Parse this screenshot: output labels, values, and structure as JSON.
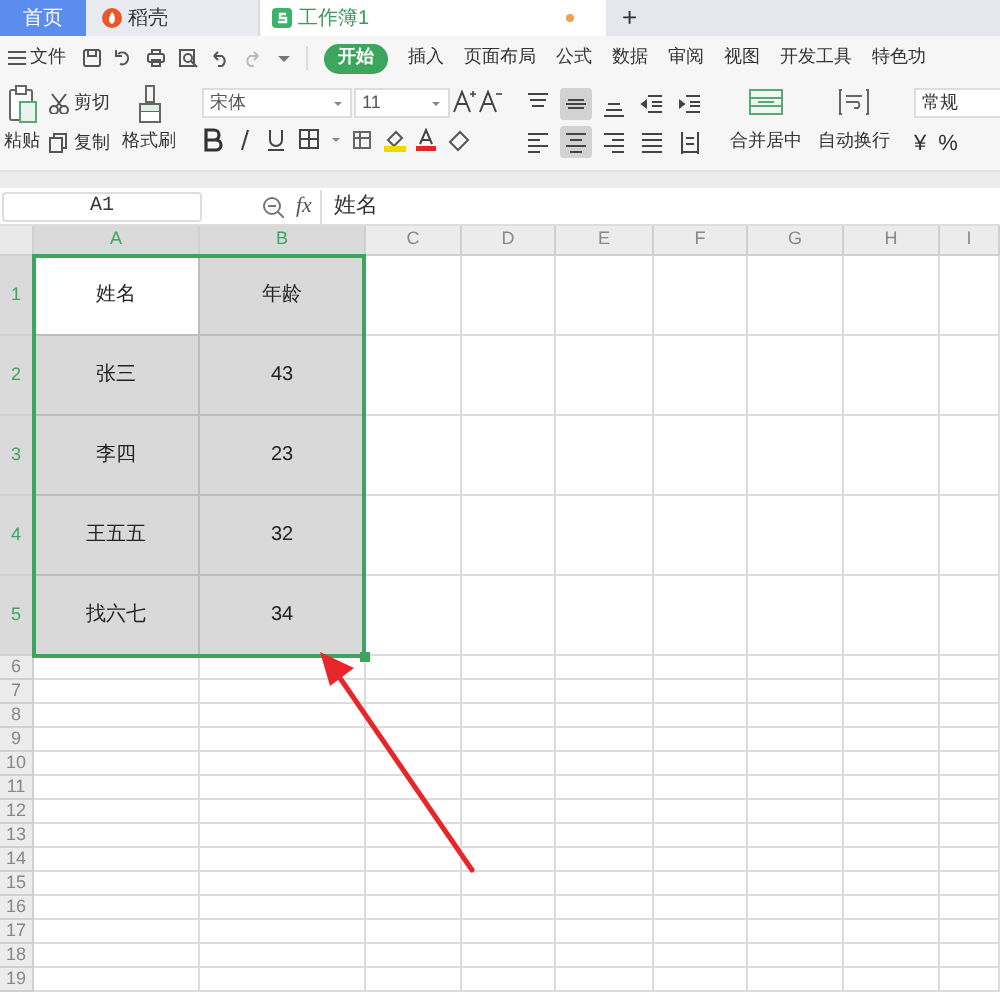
{
  "doc_tabs": [
    {
      "label": "首页",
      "kind": "home",
      "selected": false
    },
    {
      "label": "稻壳",
      "kind": "docer",
      "selected": false
    },
    {
      "label": "工作簿1",
      "kind": "sheet",
      "selected": true,
      "unsaved": true
    }
  ],
  "new_tab": "+",
  "menu": {
    "file": "文件",
    "tabs": [
      {
        "label": "开始",
        "selected": true
      },
      {
        "label": "插入",
        "selected": false
      },
      {
        "label": "页面布局",
        "selected": false
      },
      {
        "label": "公式",
        "selected": false
      },
      {
        "label": "数据",
        "selected": false
      },
      {
        "label": "审阅",
        "selected": false
      },
      {
        "label": "视图",
        "selected": false
      },
      {
        "label": "开发工具",
        "selected": false
      },
      {
        "label": "特色功",
        "selected": false
      }
    ]
  },
  "ribbon": {
    "paste": "粘贴",
    "cut": "剪切",
    "copy": "复制",
    "format_painter": "格式刷",
    "font": "宋体",
    "font_size": "11",
    "merge": "合并居中",
    "wrap": "自动换行",
    "number_format": "常规",
    "currency": "¥",
    "percent": "%",
    "align_top": [
      {
        "kind": "top",
        "selected": false
      },
      {
        "kind": "middle",
        "selected": true
      },
      {
        "kind": "bottom",
        "selected": false
      },
      {
        "kind": "outdent",
        "selected": false
      },
      {
        "kind": "indent",
        "selected": false
      }
    ],
    "align_bottom": [
      {
        "kind": "left",
        "selected": false
      },
      {
        "kind": "center",
        "selected": true
      },
      {
        "kind": "right",
        "selected": false
      },
      {
        "kind": "justify",
        "selected": false
      },
      {
        "kind": "distribute",
        "selected": false
      }
    ]
  },
  "formula_bar": {
    "cell": "A1",
    "fx": "fx",
    "value": "姓名"
  },
  "columns": [
    {
      "label": "A",
      "selected": true
    },
    {
      "label": "B",
      "selected": true
    },
    {
      "label": "C",
      "selected": false
    },
    {
      "label": "D",
      "selected": false
    },
    {
      "label": "E",
      "selected": false
    },
    {
      "label": "F",
      "selected": false
    },
    {
      "label": "G",
      "selected": false
    },
    {
      "label": "H",
      "selected": false
    },
    {
      "label": "I",
      "selected": false
    }
  ],
  "rows": [
    {
      "number": "1",
      "selected": true,
      "cells": [
        {
          "text": "姓名",
          "active": true
        },
        {
          "text": "年龄",
          "active": false
        }
      ]
    },
    {
      "number": "2",
      "selected": true,
      "cells": [
        {
          "text": "张三",
          "active": false
        },
        {
          "text": "43",
          "active": false
        }
      ]
    },
    {
      "number": "3",
      "selected": true,
      "cells": [
        {
          "text": "李四",
          "active": false
        },
        {
          "text": "23",
          "active": false
        }
      ]
    },
    {
      "number": "4",
      "selected": true,
      "cells": [
        {
          "text": "王五五",
          "active": false
        },
        {
          "text": "32",
          "active": false
        }
      ]
    },
    {
      "number": "5",
      "selected": true,
      "cells": [
        {
          "text": "找六七",
          "active": false
        },
        {
          "text": "34",
          "active": false
        }
      ]
    },
    {
      "number": "6",
      "selected": false,
      "cells": []
    },
    {
      "number": "7",
      "selected": false,
      "cells": []
    },
    {
      "number": "8",
      "selected": false,
      "cells": []
    },
    {
      "number": "9",
      "selected": false,
      "cells": []
    },
    {
      "number": "10",
      "selected": false,
      "cells": []
    },
    {
      "number": "11",
      "selected": false,
      "cells": []
    },
    {
      "number": "12",
      "selected": false,
      "cells": []
    },
    {
      "number": "13",
      "selected": false,
      "cells": []
    },
    {
      "number": "14",
      "selected": false,
      "cells": []
    },
    {
      "number": "15",
      "selected": false,
      "cells": []
    },
    {
      "number": "16",
      "selected": false,
      "cells": []
    },
    {
      "number": "17",
      "selected": false,
      "cells": []
    },
    {
      "number": "18",
      "selected": false,
      "cells": []
    },
    {
      "number": "19",
      "selected": false,
      "cells": []
    }
  ],
  "annotation": {
    "kind": "arrow"
  }
}
